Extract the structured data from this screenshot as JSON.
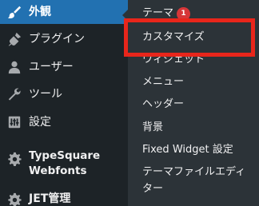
{
  "sidebar": {
    "items": [
      {
        "label": "外観",
        "icon": "paintbrush-icon",
        "current": true
      },
      {
        "label": "プラグイン",
        "icon": "plugin-icon"
      },
      {
        "label": "ユーザー",
        "icon": "user-icon"
      },
      {
        "label": "ツール",
        "icon": "wrench-icon"
      },
      {
        "label": "設定",
        "icon": "settings-sliders-icon"
      },
      {
        "label": "TypeSquare\nWebfonts",
        "icon": "gear-icon"
      },
      {
        "label": "JET管理",
        "icon": "gear-icon"
      }
    ]
  },
  "submenu": {
    "items": [
      {
        "label": "テーマ",
        "badge": "1"
      },
      {
        "label": "カスタマイズ",
        "highlighted": true
      },
      {
        "label": "ウィジェット"
      },
      {
        "label": "メニュー"
      },
      {
        "label": "ヘッダー"
      },
      {
        "label": "背景"
      },
      {
        "label": "Fixed Widget 設定"
      },
      {
        "label": "テーマファイルエディター"
      }
    ]
  },
  "colors": {
    "sidebar_bg": "#1d2327",
    "submenu_bg": "#2c3338",
    "current_bg": "#2271b1",
    "badge": "#d63638",
    "highlight_border": "#e8261b"
  }
}
